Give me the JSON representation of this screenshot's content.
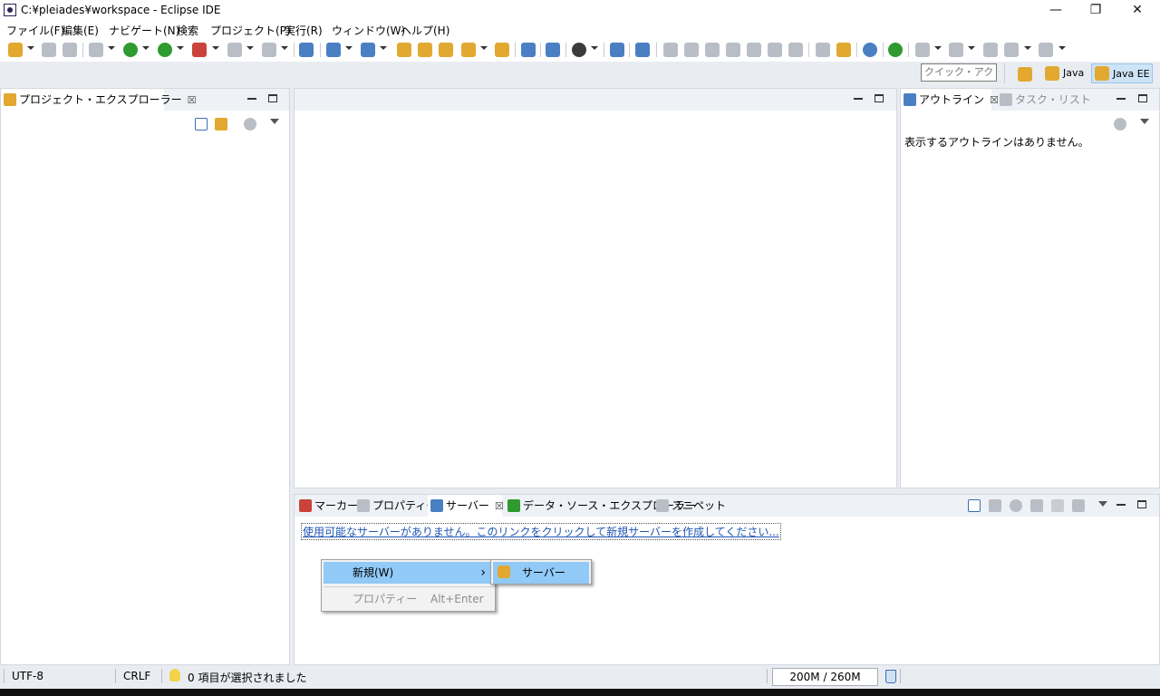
{
  "window": {
    "title": "C:¥pleiades¥workspace - Eclipse IDE",
    "minimize_icon": "—",
    "restore_icon": "❐",
    "close_icon": "✕"
  },
  "menubar": {
    "items": [
      "ファイル(F)",
      "編集(E)",
      "ナビゲート(N)",
      "検索",
      "プロジェクト(P)",
      "実行(R)",
      "ウィンドウ(W)",
      "ヘルプ(H)"
    ]
  },
  "perspectives": {
    "quick_access_placeholder": "クイック・アクセス",
    "java": "Java",
    "java_ee": "Java EE"
  },
  "project_explorer": {
    "title": "プロジェクト・エクスプローラー",
    "close": "☒"
  },
  "outline": {
    "title": "アウトライン",
    "close": "☒",
    "task_list_tab": "タスク・リスト",
    "empty_message": "表示するアウトラインはありません。"
  },
  "bottom_panel": {
    "tabs": {
      "markers": "マーカー",
      "properties": "プロパティー",
      "servers": "サーバー",
      "servers_close": "☒",
      "data_source": "データ・ソース・エクスプローラー",
      "snippets": "スニペット"
    },
    "server_link": "使用可能なサーバーがありません。このリンクをクリックして新規サーバーを作成してください..."
  },
  "context_menu": {
    "new_label": "新規(W)",
    "submenu_arrow": "›",
    "properties_label": "プロパティー",
    "properties_shortcut": "Alt+Enter",
    "submenu_server": "サーバー"
  },
  "statusbar": {
    "encoding": "UTF-8",
    "line_ending": "CRLF",
    "selection": "0 項目が選択されました",
    "heap": "200M / 260M"
  },
  "colors": {
    "accent_highlight": "#91c9f7",
    "link": "#1f56b5",
    "background": "#e9edf2"
  }
}
